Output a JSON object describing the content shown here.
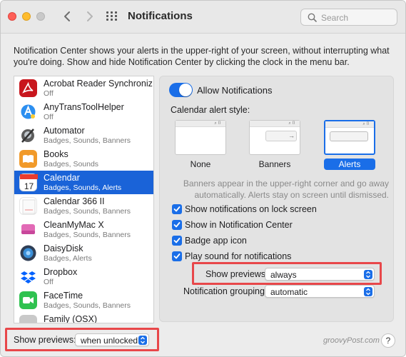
{
  "window": {
    "title": "Notifications"
  },
  "search": {
    "placeholder": "Search",
    "icon": "magnifier"
  },
  "description": "Notification Center shows your alerts in the upper-right of your screen, without interrupting what you're doing. Show and hide Notification Center by clicking the clock in the menu bar.",
  "apps": [
    {
      "name": "Acrobat Reader Synchroniz...",
      "sub": "Off",
      "icon": "acrobat-icon",
      "color": "#c8161d"
    },
    {
      "name": "AnyTransToolHelper",
      "sub": "Off",
      "icon": "anytrans-icon",
      "color": "#2c8ff0"
    },
    {
      "name": "Automator",
      "sub": "Badges, Sounds, Banners",
      "icon": "automator-icon",
      "color": "#6a6a6a"
    },
    {
      "name": "Books",
      "sub": "Badges, Sounds",
      "icon": "books-icon",
      "color": "#f19a2a"
    },
    {
      "name": "Calendar",
      "sub": "Badges, Sounds, Alerts",
      "icon": "calendar-icon",
      "color": "#ffffff",
      "selected": true
    },
    {
      "name": "Calendar 366 II",
      "sub": "Badges, Sounds, Banners",
      "icon": "calendar366-icon",
      "color": "#ffffff"
    },
    {
      "name": "CleanMyMac X",
      "sub": "Badges, Sounds, Banners",
      "icon": "cleanmymac-icon",
      "color": "#e26ab6"
    },
    {
      "name": "DaisyDisk",
      "sub": "Badges, Alerts",
      "icon": "daisydisk-icon",
      "color": "#2a6fb5"
    },
    {
      "name": "Dropbox",
      "sub": "Off",
      "icon": "dropbox-icon",
      "color": "#0061fe"
    },
    {
      "name": "FaceTime",
      "sub": "Badges, Sounds, Banners",
      "icon": "facetime-icon",
      "color": "#2fc250"
    },
    {
      "name": "Family (OSX)",
      "sub": "",
      "icon": "family-icon",
      "color": "#b0b0b0"
    }
  ],
  "settings": {
    "allow_label": "Allow Notifications",
    "allow_on": true,
    "style_label": "Calendar alert style:",
    "styles": {
      "none": "None",
      "banners": "Banners",
      "alerts": "Alerts",
      "selected": "Alerts"
    },
    "note": "Banners appear in the upper-right corner and go away automatically. Alerts stay on screen until dismissed.",
    "checkboxes": [
      {
        "label": "Show notifications on lock screen",
        "checked": true
      },
      {
        "label": "Show in Notification Center",
        "checked": true
      },
      {
        "label": "Badge app icon",
        "checked": true
      },
      {
        "label": "Play sound for notifications",
        "checked": true
      }
    ],
    "show_previews_label": "Show previews",
    "show_previews_value": "always",
    "grouping_label": "Notification grouping",
    "grouping_value": "automatic"
  },
  "footer": {
    "show_previews_label": "Show previews:",
    "show_previews_value": "when unlocked",
    "watermark": "groovyPost.com",
    "help": "?"
  },
  "colors": {
    "accent": "#1a6ee8",
    "selection": "#1a63d8",
    "highlight": "#e8474a"
  }
}
